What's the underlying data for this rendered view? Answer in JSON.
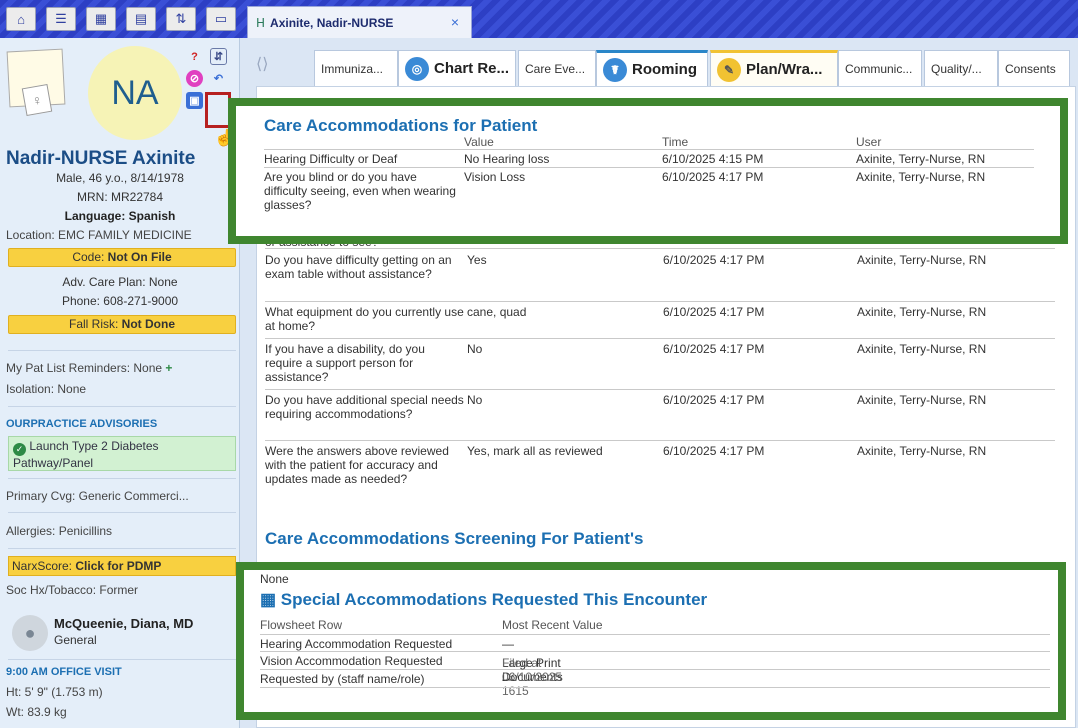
{
  "toolbar": {
    "icons": [
      "home-icon",
      "inbox-icon",
      "schedule-icon",
      "calendar-icon",
      "list-icon",
      "window-icon"
    ],
    "icon_glyphs": [
      "⌂",
      "☰",
      "▦",
      "▤",
      "⇅",
      "▭"
    ]
  },
  "patient_tab": {
    "label": "Axinite, Nadir-NURSE",
    "close": "×",
    "icon": "ᕼ"
  },
  "sidebar": {
    "initials": "NA",
    "name": "Nadir-NURSE Axinite",
    "demographics": "Male, 46 y.o., 8/14/1978",
    "mrn": "MRN: MR22784",
    "language": "Language: Spanish",
    "location": "Location: EMC FAMILY MEDICINE",
    "code_label": "Code: ",
    "code_value": "Not On File",
    "adv_care_plan": "Adv. Care Plan: None",
    "phone": "Phone: 608-271-9000",
    "fall_risk_label": "Fall Risk: ",
    "fall_risk_value": "Not Done",
    "reminders_label": "My Pat List Reminders: None",
    "reminders_add": "+",
    "isolation": "Isolation: None",
    "advisories_header": "OURPRACTICE ADVISORIES",
    "advisory_text": "Launch Type 2 Diabetes Pathway/Panel",
    "primary_cvg": "Primary Cvg: Generic Commerci...",
    "allergies": "Allergies: Penicillins",
    "narx_label": "NarxScore: ",
    "narx_value": "Click for PDMP",
    "soc_hx": "Soc Hx/Tobacco: Former",
    "provider_name": "McQueenie, Diana, MD",
    "provider_specialty": "General",
    "visit_header": "9:00 AM OFFICE VISIT",
    "height": "Ht: 5' 9\" (1.753 m)",
    "weight": "Wt: 83.9 kg",
    "icon_q": "?",
    "icon_hier": "⇵",
    "icon_no": "⊘",
    "icon_back": "↶",
    "icon_card": "▣",
    "icon_person": "●"
  },
  "activity_tabs": [
    {
      "label": "Immuniza..."
    },
    {
      "label": "Chart Re..."
    },
    {
      "label": "Care Eve..."
    },
    {
      "label": "Rooming"
    },
    {
      "label": "Plan/Wra..."
    },
    {
      "label": "Communic..."
    },
    {
      "label": "Quality/..."
    },
    {
      "label": "Consents"
    }
  ],
  "nav_arrows": "⟨⟩",
  "care_accommodations": {
    "title": "Care Accommodations for Patient",
    "headers": {
      "value": "Value",
      "time": "Time",
      "user": "User"
    },
    "rows": [
      {
        "q": "Hearing Difficulty or Deaf",
        "v": "No Hearing loss",
        "t": "6/10/2025 4:15 PM",
        "u": "Axinite, Terry-Nurse, RN"
      },
      {
        "q": "Are you blind or do you have difficulty seeing, even when wearing glasses?",
        "v": "Vision Loss",
        "t": "6/10/2025 4:17 PM",
        "u": "Axinite, Terry-Nurse, RN"
      }
    ]
  },
  "report_rows": [
    {
      "q": "or assistance to see?",
      "v": "",
      "t": "",
      "u": ""
    },
    {
      "q": "Do you have difficulty getting on an exam table without assistance?",
      "v": "Yes",
      "t": "6/10/2025 4:17 PM",
      "u": "Axinite, Terry-Nurse, RN"
    },
    {
      "q": "What equipment do you currently use at home?",
      "v": "cane, quad",
      "t": "6/10/2025 4:17 PM",
      "u": "Axinite, Terry-Nurse, RN"
    },
    {
      "q": "If you have a disability, do you require a support person for assistance?",
      "v": "No",
      "t": "6/10/2025 4:17 PM",
      "u": "Axinite, Terry-Nurse, RN"
    },
    {
      "q": "Do you have additional special needs requiring accommodations?",
      "v": "No",
      "t": "6/10/2025 4:17 PM",
      "u": "Axinite, Terry-Nurse, RN"
    },
    {
      "q": "Were the answers above reviewed with the patient for accuracy and updates made as needed?",
      "v": "Yes, mark all as reviewed",
      "t": "6/10/2025 4:17 PM",
      "u": "Axinite, Terry-Nurse, RN"
    }
  ],
  "screening_title": "Care Accommodations Screening For Patient's",
  "special_accommodations": {
    "none_text": "None",
    "title": "Special Accommodations Requested This Encounter",
    "icon": "▦",
    "headers": {
      "row": "Flowsheet Row",
      "value": "Most Recent Value"
    },
    "rows": [
      {
        "row": "Hearing Accommodation Requested",
        "value": "—",
        "filed": ""
      },
      {
        "row": "Vision Accommodation Requested",
        "value": "Large Print Documents",
        "filed": "Filed at 06/10/2025 1615"
      },
      {
        "row": "Requested by (staff name/role)",
        "value": "—",
        "filed": ""
      }
    ]
  },
  "colors": {
    "overlay_border": "#3f862f",
    "section_title": "#1c6fb2",
    "toolbar_blue": "#2d3fc4",
    "alert_yellow": "#f8d040"
  }
}
